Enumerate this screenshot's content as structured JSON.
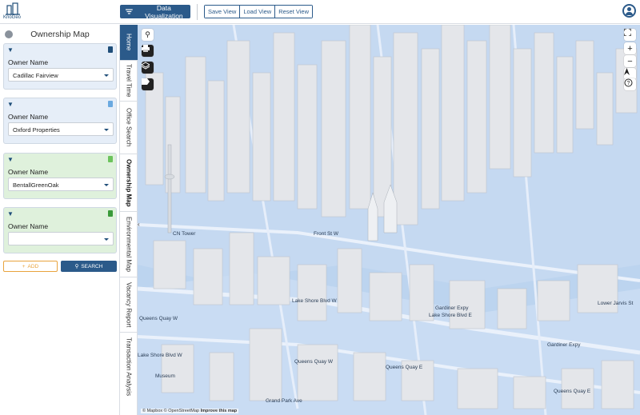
{
  "app": {
    "logo_text": "KnoGeo"
  },
  "toolbar": {
    "data_viz_label": "Data Visualization",
    "save_view": "Save View",
    "load_view": "Load View",
    "reset_view": "Reset View"
  },
  "panel": {
    "title": "Ownership Map",
    "cards": [
      {
        "label": "Owner Name",
        "value": "Cadillac Fairview",
        "bg": "#e6eef8"
      },
      {
        "label": "Owner Name",
        "value": "Oxford Properties",
        "bg": "#e6eef8"
      },
      {
        "label": "Owner Name",
        "value": "BentallGreenOak",
        "bg": "#dff1dc"
      },
      {
        "label": "Owner Name",
        "value": "",
        "bg": "#dff1dc"
      }
    ],
    "add_label": "ADD",
    "search_label": "SEARCH"
  },
  "tabs": [
    {
      "label": "Home"
    },
    {
      "label": "Travel Time"
    },
    {
      "label": "Office Search"
    },
    {
      "label": "Ownership Map"
    },
    {
      "label": "Environmental Map"
    },
    {
      "label": "Vacancy Report"
    },
    {
      "label": "Transaction Analysis"
    }
  ],
  "map": {
    "labels": {
      "cn_tower": "CN Tower",
      "front_st": "Front St W",
      "lake_shore": "Lake Shore Blvd W",
      "gardiner": "Gardiner Expy",
      "lake_shore_e": "Lake Shore Blvd E",
      "gardiner2": "Gardiner Expy",
      "queens_quay": "Queens Quay W",
      "queens_quay2": "Queens Quay W",
      "queens_quay_e": "Queens Quay E",
      "queens_quay_e2": "Queens Quay E",
      "lower_jarvis": "Lower Jarvis St",
      "lake_shore_w": "Lake Shore Blvd W",
      "museum": "Museum",
      "grand_park": "Grand Park Ave"
    },
    "attribution_prefix": "© Mapbox © OpenStreetMap",
    "attribution_link": "Improve this map"
  },
  "colors": {
    "accent": "#2b5a8a",
    "warning": "#e8a33d",
    "map_water": "#bcd4ef"
  }
}
